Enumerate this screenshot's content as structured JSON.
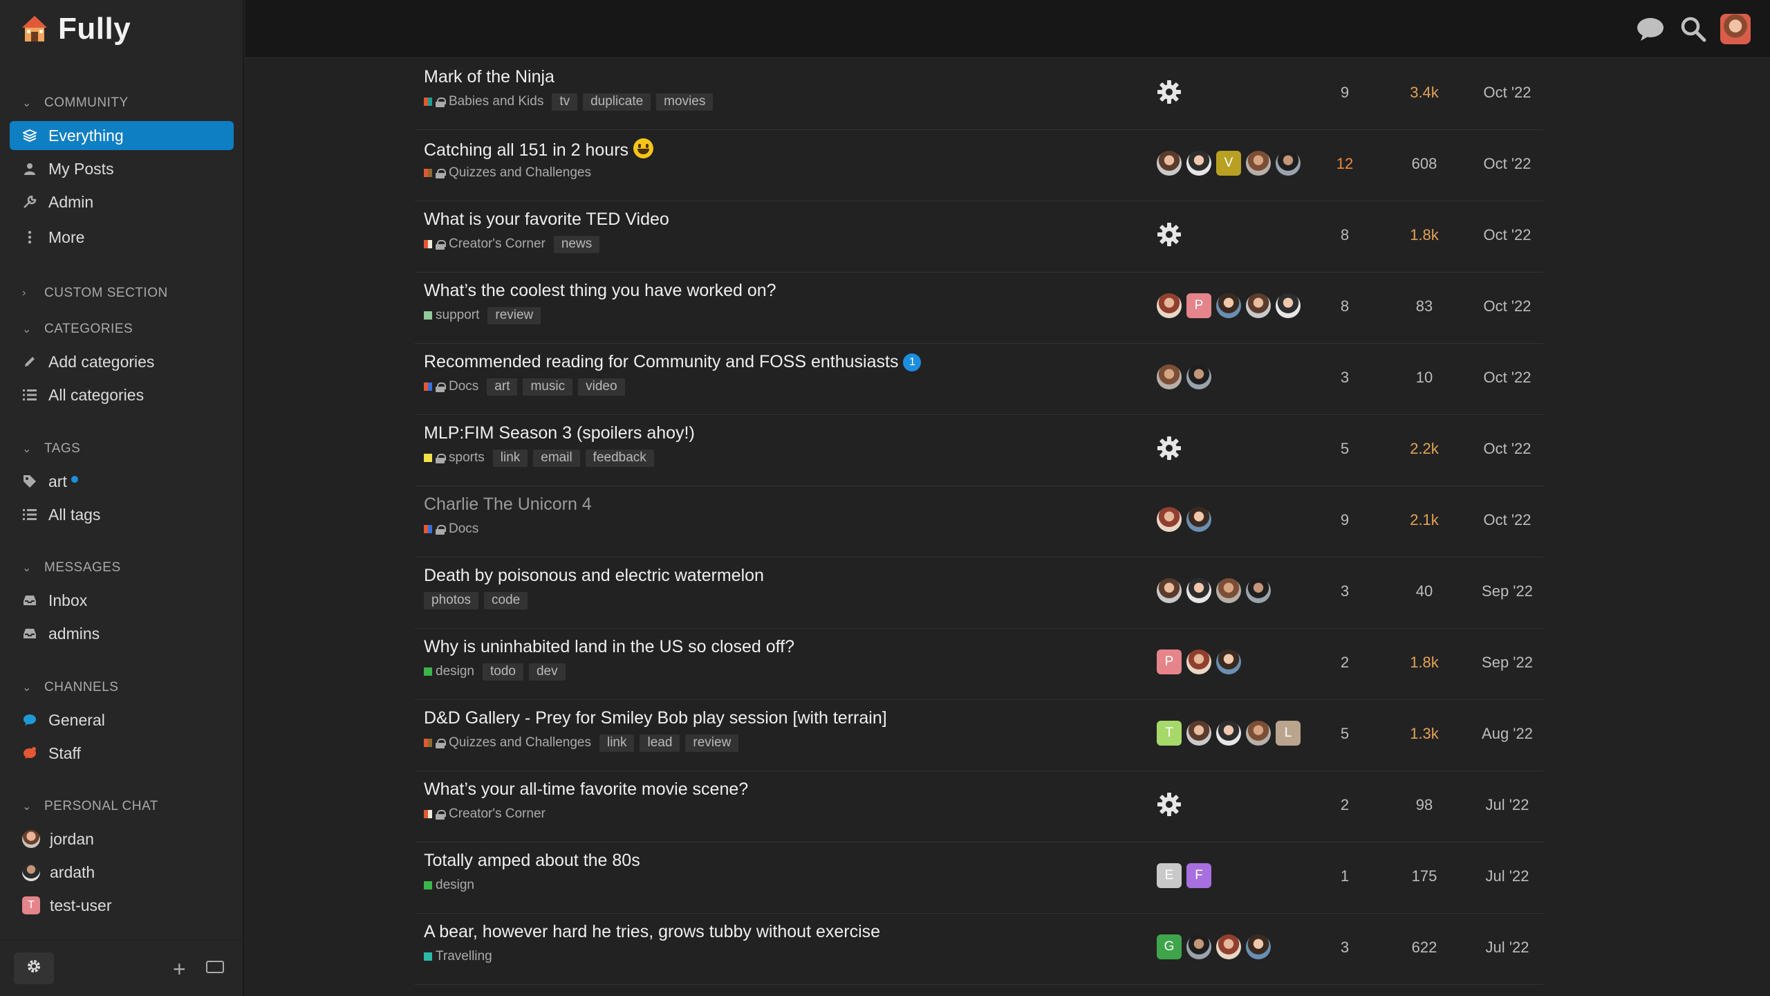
{
  "app": {
    "name": "Fully"
  },
  "sidebar": {
    "community": {
      "heading": "COMMUNITY",
      "items": [
        {
          "label": "Everything",
          "icon": "layers-icon",
          "active": true
        },
        {
          "label": "My Posts",
          "icon": "user-icon"
        },
        {
          "label": "Admin",
          "icon": "wrench-icon"
        },
        {
          "label": "More",
          "icon": "more-vertical-icon"
        }
      ]
    },
    "custom": {
      "heading": "CUSTOM SECTION"
    },
    "categories": {
      "heading": "CATEGORIES",
      "items": [
        {
          "label": "Add categories",
          "icon": "pencil-icon"
        },
        {
          "label": "All categories",
          "icon": "list-icon"
        }
      ]
    },
    "tags": {
      "heading": "TAGS",
      "items": [
        {
          "label": "art",
          "icon": "tag-icon"
        },
        {
          "label": "All tags",
          "icon": "list-icon"
        }
      ]
    },
    "messages": {
      "heading": "MESSAGES",
      "items": [
        {
          "label": "Inbox",
          "icon": "inbox-icon"
        },
        {
          "label": "admins",
          "icon": "inbox-icon"
        }
      ]
    },
    "channels": {
      "heading": "CHANNELS",
      "items": [
        {
          "label": "General",
          "icon": "chat-bubble-icon",
          "color": "#1d9ad6"
        },
        {
          "label": "Staff",
          "icon": "chat-bubble-icon",
          "color": "#e45735"
        }
      ]
    },
    "personal_chat": {
      "heading": "PERSONAL CHAT",
      "items": [
        {
          "label": "jordan"
        },
        {
          "label": "ardath"
        },
        {
          "label": "test-user"
        }
      ]
    }
  },
  "colors": {
    "accent": "#0f7fc4",
    "hot_replies": "#ef8a3b",
    "hot_views": "#e3a354",
    "new_badge": "#1d8ede"
  },
  "topics": [
    {
      "title": "Mark of the Ninja",
      "category": "Babies and Kids",
      "cat_colors": [
        "#e45735",
        "#1e9e8f"
      ],
      "locked": true,
      "tags": [
        "tv",
        "duplicate",
        "movies"
      ],
      "posters": [
        "gear-icon"
      ],
      "replies": "9",
      "views": "3.4k",
      "views_hot": true,
      "activity": "Oct '22"
    },
    {
      "title": "Catching all 151 in 2 hours",
      "emoji": true,
      "category": "Quizzes and Challenges",
      "cat_colors": [
        "#e45735",
        "#8f6a2f"
      ],
      "locked": true,
      "tags": [],
      "posters": [
        "photo",
        "photo",
        "V",
        "photo",
        "photo"
      ],
      "replies": "12",
      "replies_hot": true,
      "views": "608",
      "activity": "Oct '22"
    },
    {
      "title": "What is your favorite TED Video",
      "category": "Creator's Corner",
      "cat_colors": [
        "#e45735",
        "#f0eada"
      ],
      "locked": true,
      "tags": [
        "news"
      ],
      "posters": [
        "gear-icon"
      ],
      "replies": "8",
      "views": "1.8k",
      "views_hot": true,
      "activity": "Oct '22"
    },
    {
      "title": "What’s the coolest thing you have worked on?",
      "category": "support",
      "cat_colors": [
        "#92c89b"
      ],
      "locked": false,
      "tags": [
        "review"
      ],
      "posters": [
        "photo",
        "P",
        "photo",
        "photo",
        "photo"
      ],
      "replies": "8",
      "views": "83",
      "activity": "Oct '22"
    },
    {
      "title": "Recommended reading for Community and FOSS enthusiasts",
      "new_count": "1",
      "category": "Docs",
      "cat_colors": [
        "#e45735",
        "#3a6fdb"
      ],
      "locked": true,
      "tags": [
        "art",
        "music",
        "video"
      ],
      "posters": [
        "photo",
        "photo"
      ],
      "replies": "3",
      "views": "10",
      "activity": "Oct '22"
    },
    {
      "title": "MLP:FIM Season 3 (spoilers ahoy!)",
      "category": "sports",
      "cat_colors": [
        "#f3e04a"
      ],
      "locked": true,
      "tags": [
        "link",
        "email",
        "feedback"
      ],
      "posters": [
        "gear-icon"
      ],
      "replies": "5",
      "views": "2.2k",
      "views_hot": true,
      "activity": "Oct '22"
    },
    {
      "title": "Charlie The Unicorn 4",
      "visited": true,
      "category": "Docs",
      "cat_colors": [
        "#e45735",
        "#3a6fdb"
      ],
      "locked": true,
      "tags": [],
      "posters": [
        "photo",
        "photo"
      ],
      "replies": "9",
      "views": "2.1k",
      "views_hot": true,
      "activity": "Oct '22"
    },
    {
      "title": "Death by poisonous and electric watermelon",
      "category": "",
      "cat_colors": [],
      "locked": false,
      "tags": [
        "photos",
        "code"
      ],
      "posters": [
        "photo",
        "photo",
        "photo",
        "photo"
      ],
      "replies": "3",
      "views": "40",
      "activity": "Sep '22"
    },
    {
      "title": "Why is uninhabited land in the US so closed off?",
      "category": "design",
      "cat_colors": [
        "#3ab54a"
      ],
      "locked": false,
      "tags": [
        "todo",
        "dev"
      ],
      "posters": [
        "P",
        "photo",
        "photo"
      ],
      "replies": "2",
      "views": "1.8k",
      "views_hot": true,
      "activity": "Sep '22"
    },
    {
      "title": "D&D Gallery - Prey for Smiley Bob play session [with terrain]",
      "category": "Quizzes and Challenges",
      "cat_colors": [
        "#e45735",
        "#8f6a2f"
      ],
      "locked": true,
      "tags": [
        "link",
        "lead",
        "review"
      ],
      "posters": [
        "T",
        "photo",
        "photo",
        "photo",
        "L"
      ],
      "replies": "5",
      "views": "1.3k",
      "views_hot": true,
      "activity": "Aug '22"
    },
    {
      "title": "What’s your all-time favorite movie scene?",
      "category": "Creator's Corner",
      "cat_colors": [
        "#e45735",
        "#f0eada"
      ],
      "locked": true,
      "tags": [],
      "posters": [
        "gear-icon"
      ],
      "replies": "2",
      "views": "98",
      "activity": "Jul '22"
    },
    {
      "title": "Totally amped about the 80s",
      "category": "design",
      "cat_colors": [
        "#3ab54a"
      ],
      "locked": false,
      "tags": [],
      "posters": [
        "E",
        "F"
      ],
      "replies": "1",
      "views": "175",
      "activity": "Jul '22"
    },
    {
      "title": "A bear, however hard he tries, grows tubby without exercise",
      "category": "Travelling",
      "cat_colors": [
        "#2cb8a6"
      ],
      "locked": false,
      "tags": [],
      "posters": [
        "G",
        "photo",
        "photo",
        "photo"
      ],
      "replies": "3",
      "views": "622",
      "activity": "Jul '22"
    }
  ]
}
